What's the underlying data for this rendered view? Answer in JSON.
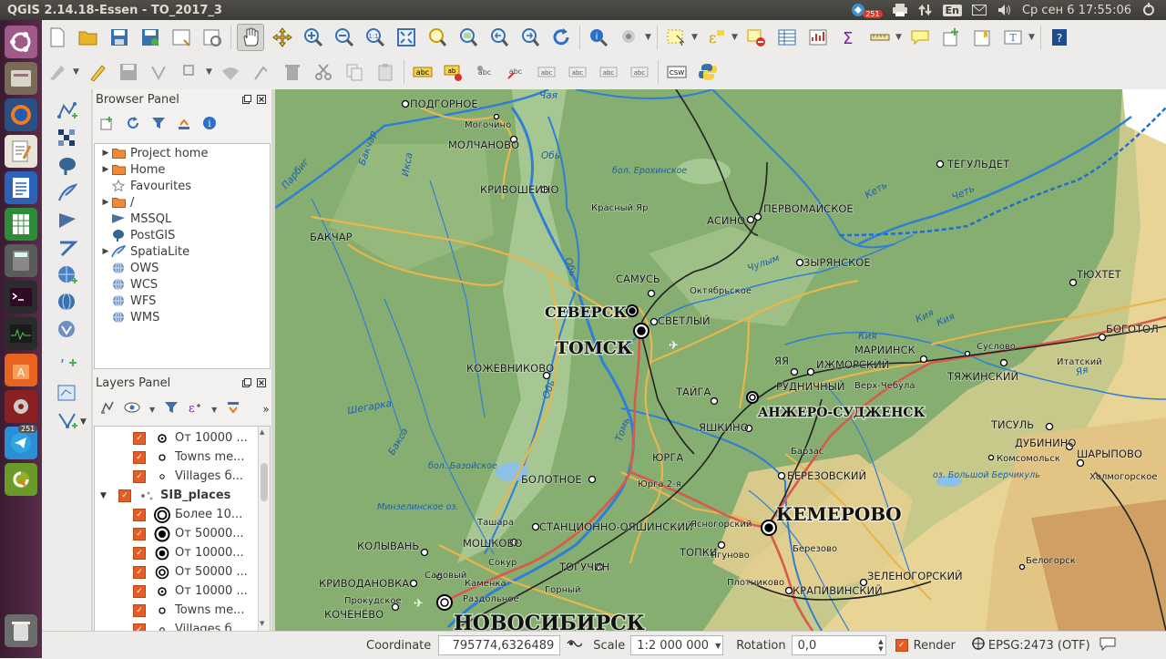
{
  "window": {
    "title": "QGIS 2.14.18-Essen - TO_2017_3"
  },
  "tray": {
    "notify_count": "251",
    "lang": "En",
    "datetime": "Ср сен 6 17:55:06"
  },
  "launcher": {
    "badge": "251"
  },
  "browser_panel": {
    "title": "Browser Panel",
    "items": [
      {
        "label": "Project home",
        "icon": "folder-icon",
        "expandable": true
      },
      {
        "label": "Home",
        "icon": "folder-icon",
        "expandable": true
      },
      {
        "label": "Favourites",
        "icon": "star-icon",
        "expandable": false
      },
      {
        "label": "/",
        "icon": "folder-icon",
        "expandable": true
      },
      {
        "label": "MSSQL",
        "icon": "mssql-icon",
        "expandable": false
      },
      {
        "label": "PostGIS",
        "icon": "postgis-icon",
        "expandable": false
      },
      {
        "label": "SpatiaLite",
        "icon": "spatialite-icon",
        "expandable": true
      },
      {
        "label": "OWS",
        "icon": "globe-icon",
        "expandable": false
      },
      {
        "label": "WCS",
        "icon": "globe-icon",
        "expandable": false
      },
      {
        "label": "WFS",
        "icon": "globe-icon",
        "expandable": false
      },
      {
        "label": "WMS",
        "icon": "globe-icon",
        "expandable": false
      }
    ]
  },
  "layers_panel": {
    "title": "Layers Panel",
    "rows": [
      {
        "label": "От 10000 ...",
        "symbol": "dot-small-ring",
        "indent": 2
      },
      {
        "label": "Towns me...",
        "symbol": "dot-hollow",
        "indent": 2
      },
      {
        "label": "Villages б...",
        "symbol": "dot-tiny",
        "indent": 2
      },
      {
        "label": "SIB_places",
        "symbol": "group",
        "indent": 1,
        "group": true
      },
      {
        "label": "Более 10...",
        "symbol": "ring-large",
        "indent": 2
      },
      {
        "label": "От 50000...",
        "symbol": "dot-big",
        "indent": 2
      },
      {
        "label": "От 10000...",
        "symbol": "dot-ring",
        "indent": 2
      },
      {
        "label": "От 50000 ...",
        "symbol": "ring-double",
        "indent": 2
      },
      {
        "label": "От 10000 ...",
        "symbol": "dot-small-ring",
        "indent": 2
      },
      {
        "label": "Towns me...",
        "symbol": "dot-hollow",
        "indent": 2
      },
      {
        "label": "Villages б...",
        "symbol": "dot-tiny",
        "indent": 2
      }
    ]
  },
  "map": {
    "labels_big": [
      {
        "text": "ТОМСК"
      },
      {
        "text": "СЕВЕРСК"
      },
      {
        "text": "КЕМЕРОВО"
      },
      {
        "text": "НОВОСИБИРСК"
      },
      {
        "text": "АНЖЕРО-СУДЖЕНСК"
      }
    ],
    "labels": [
      "ПОДГОРНОЕ",
      "Могочино",
      "МОЛЧАНОВО",
      "КРИВОШЕИНО",
      "Красный Яр",
      "БАКЧАР",
      "АСИНО",
      "ПЕРВОМАЙСКОЕ",
      "ЗЫРЯНСКОЕ",
      "ТЕГУЛЬДЕТ",
      "САМУСЬ",
      "Октябрьское",
      "СВЕТЛЫЙ",
      "ТЮХТЕТ",
      "БОГОТОЛ",
      "МАРИИНСК",
      "Суслово",
      "Итатский",
      "ТЯЖИНСКИЙ",
      "ЯЯ",
      "ИЖМОРСКИЙ",
      "РУДНИЧНЫЙ",
      "Верх-Чебула",
      "КОЖЕВНИКОВО",
      "ТАЙГА",
      "ЯШКИНО",
      "ЮРГА",
      "Юрга 2-я",
      "БОЛОТНОЕ",
      "ТИСУЛЬ",
      "ДУБИНИНО",
      "ШАРЫПОВО",
      "Комсомольск",
      "Холмогорское",
      "Барзас",
      "БЕРЕЗОВСКИЙ",
      "СТАНЦИОННО-ОЯШИНСКИЙ",
      "Ясногорский",
      "Ташара",
      "МОШКОВО",
      "КОЛЫВАНЬ",
      "ТОПКИ",
      "Ягуново",
      "Березово",
      "ТОГУЧИН",
      "Горный",
      "ЗЕЛЕНОГОРСКИЙ",
      "КРИВОДАНОВКА",
      "Плотниково",
      "КРАПИВИНСКИЙ",
      "Белогорск",
      "КОЧЕНЁВО",
      "Прокудское",
      "Каменка",
      "Раздольное",
      "Сокур",
      "Садовый"
    ],
    "water_labels": [
      "Обь",
      "Обь",
      "Обь",
      "Чая",
      "Икса",
      "Бакчар",
      "Кеть",
      "Четь",
      "Чулым",
      "Кия",
      "Кия",
      "Томь",
      "Яя",
      "Шегарка",
      "Баксa",
      "Парбиг",
      "Кия",
      "Иня",
      "бол. Ерохинское",
      "бол. Базойское",
      "Минзелинское оз.",
      "оз. Большой Берчикуль"
    ]
  },
  "status": {
    "coordinate_label": "Coordinate",
    "coordinate_value": "795774,6326489",
    "scale_label": "Scale",
    "scale_value": "1:2 000 000",
    "rotation_label": "Rotation",
    "rotation_value": "0,0",
    "render_label": "Render",
    "crs_label": "EPSG:2473 (OTF)"
  }
}
